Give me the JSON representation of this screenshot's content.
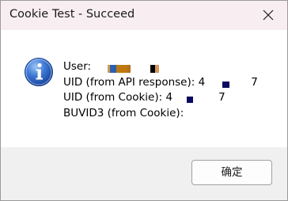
{
  "window": {
    "title": "Cookie Test - Succeed",
    "close_icon": "close-icon"
  },
  "message": {
    "icon": "info-icon",
    "lines": [
      {
        "label": "User:",
        "value": ""
      },
      {
        "label": "UID (from API response):",
        "value": "4"
      },
      {
        "label": "UID (from Cookie):",
        "value": "4"
      },
      {
        "label": "BUVID3 (from Cookie):",
        "value": ""
      }
    ],
    "uid_api_suffix": "7",
    "uid_cookie_suffix": "7"
  },
  "footer": {
    "ok_label": "确定"
  },
  "colors": {
    "titlebar_bg": "#f8eef1",
    "footer_bg": "#f0f0f0",
    "info_icon_blue": "#2f68c4"
  }
}
